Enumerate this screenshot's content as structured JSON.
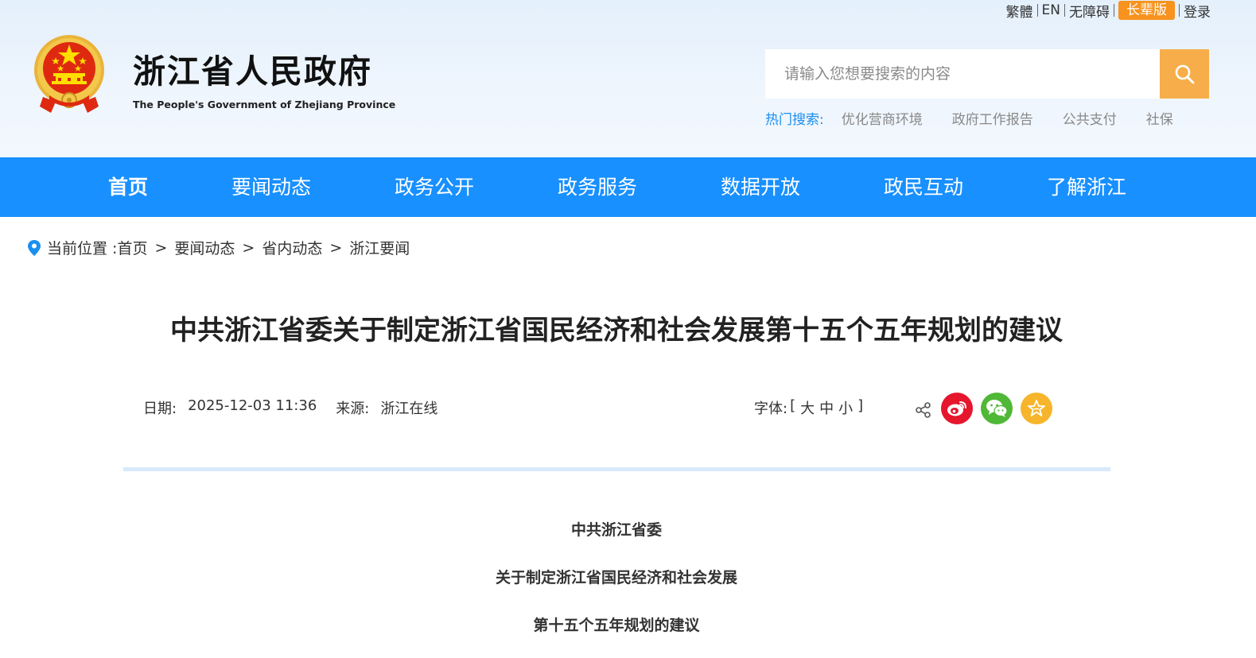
{
  "header": {
    "top_links": {
      "traditional": "繁體",
      "english": "EN",
      "accessibility": "无障碍",
      "elder_mode": "长辈版",
      "login": "登录"
    },
    "site_title": "浙江省人民政府",
    "site_subtitle": "The People's Government of Zhejiang Province",
    "search": {
      "placeholder": "请输入您想要搜索的内容",
      "button_icon": "search-icon"
    },
    "hot_search": {
      "label": "热门搜索:",
      "items": [
        "优化营商环境",
        "政府工作报告",
        "公共支付",
        "社保"
      ]
    }
  },
  "nav": {
    "items": [
      {
        "label": "首页",
        "active": true
      },
      {
        "label": "要闻动态",
        "active": false
      },
      {
        "label": "政务公开",
        "active": false
      },
      {
        "label": "政务服务",
        "active": false
      },
      {
        "label": "数据开放",
        "active": false
      },
      {
        "label": "政民互动",
        "active": false
      },
      {
        "label": "了解浙江",
        "active": false
      }
    ]
  },
  "breadcrumb": {
    "prefix": "当前位置 :",
    "items": [
      "首页",
      "要闻动态",
      "省内动态",
      "浙江要闻"
    ],
    "separator": ">"
  },
  "article": {
    "title": "中共浙江省委关于制定浙江省国民经济和社会发展第十五个五年规划的建议",
    "meta": {
      "date_label": "日期:",
      "date": "2025-12-03 11:36",
      "source_label": "来源:",
      "source": "浙江在线"
    },
    "font_size": {
      "label": "字体:",
      "open": "[",
      "large": "大",
      "medium": "中",
      "small": "小",
      "close": "]"
    },
    "share": {
      "icons": [
        "share-icon",
        "weibo-icon",
        "wechat-icon",
        "favorite-icon"
      ]
    },
    "body": [
      "中共浙江省委",
      "关于制定浙江省国民经济和社会发展",
      "第十五个五年规划的建议"
    ]
  },
  "colors": {
    "nav_bg": "#1890ff",
    "search_button": "#f7ae4a",
    "elder_badge": "#f7931e",
    "hot_label": "#1a8ff0",
    "weibo": "#e6162d",
    "wechat": "#4fb836",
    "favorite": "#f6b52a"
  }
}
